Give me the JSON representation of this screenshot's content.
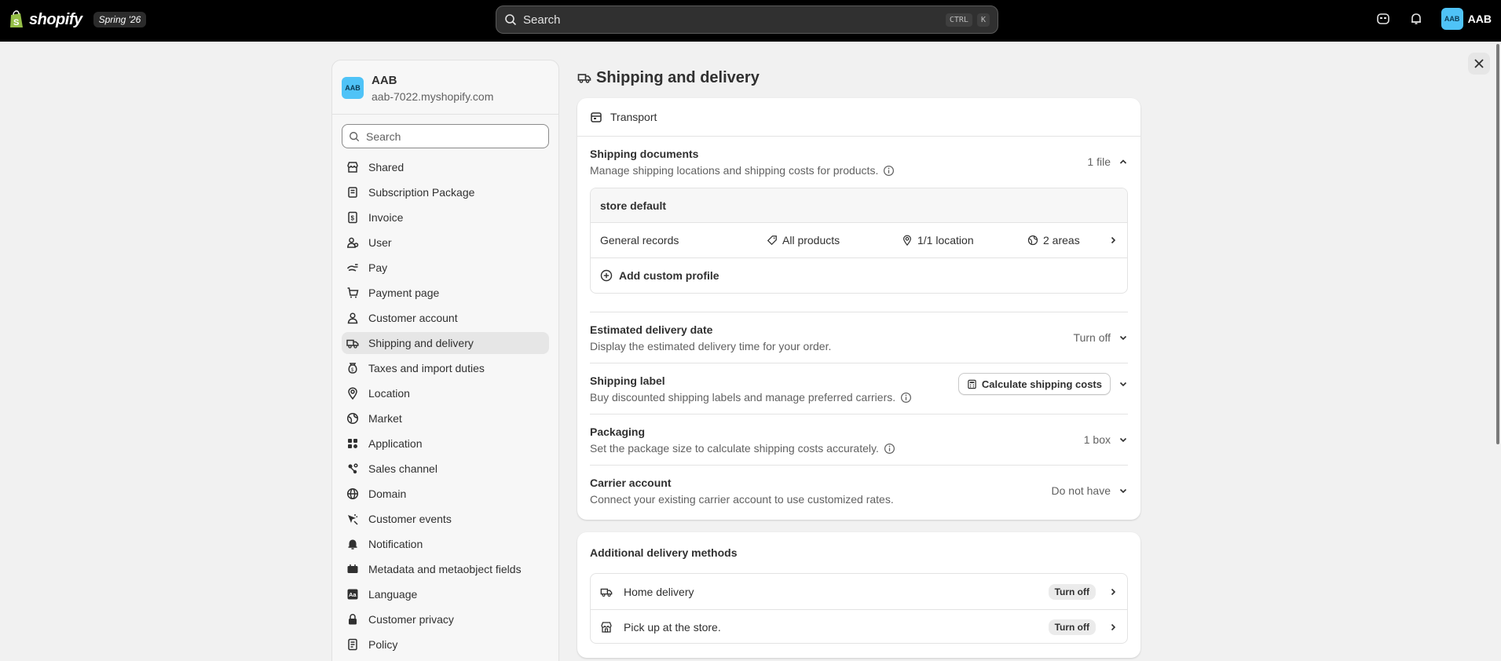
{
  "topbar": {
    "logo_text": "shopify",
    "edition": "Spring '26",
    "search_placeholder": "Search",
    "kbd_ctrl": "CTRL",
    "kbd_k": "K",
    "avatar_initials": "AAB",
    "user_label": "AAB"
  },
  "store": {
    "avatar_initials": "AAB",
    "name": "AAB",
    "domain": "aab-7022.myshopify.com"
  },
  "sidebar": {
    "search_placeholder": "Search",
    "items": [
      {
        "label": "Shared",
        "icon": "store-icon"
      },
      {
        "label": "Subscription Package",
        "icon": "plan-icon"
      },
      {
        "label": "Invoice",
        "icon": "invoice-icon"
      },
      {
        "label": "User",
        "icon": "user-icon"
      },
      {
        "label": "Pay",
        "icon": "payment-icon"
      },
      {
        "label": "Payment page",
        "icon": "cart-icon"
      },
      {
        "label": "Customer account",
        "icon": "customer-icon"
      },
      {
        "label": "Shipping and delivery",
        "icon": "truck-icon",
        "active": true
      },
      {
        "label": "Taxes and import duties",
        "icon": "tax-icon"
      },
      {
        "label": "Location",
        "icon": "location-icon"
      },
      {
        "label": "Market",
        "icon": "globe-icon"
      },
      {
        "label": "Application",
        "icon": "apps-icon"
      },
      {
        "label": "Sales channel",
        "icon": "channel-icon"
      },
      {
        "label": "Domain",
        "icon": "domain-icon"
      },
      {
        "label": "Customer events",
        "icon": "events-icon"
      },
      {
        "label": "Notification",
        "icon": "bell-icon"
      },
      {
        "label": "Metadata and metaobject fields",
        "icon": "metafield-icon"
      },
      {
        "label": "Language",
        "icon": "language-icon"
      },
      {
        "label": "Customer privacy",
        "icon": "lock-icon"
      },
      {
        "label": "Policy",
        "icon": "policy-icon"
      }
    ]
  },
  "page": {
    "title": "Shipping and delivery"
  },
  "transport": {
    "header": "Transport",
    "shipping_documents": {
      "title": "Shipping documents",
      "desc": "Manage shipping locations and shipping costs for products.",
      "count": "1 file"
    },
    "profile": {
      "name": "store default",
      "row_label": "General records",
      "products": "All products",
      "locations": "1/1 location",
      "areas": "2 areas",
      "add_label": "Add custom profile"
    },
    "estimated_delivery": {
      "title": "Estimated delivery date",
      "desc": "Display the estimated delivery time for your order.",
      "status": "Turn off"
    },
    "shipping_label": {
      "title": "Shipping label",
      "desc": "Buy discounted shipping labels and manage preferred carriers.",
      "button": "Calculate shipping costs"
    },
    "packaging": {
      "title": "Packaging",
      "desc": "Set the package size to calculate shipping costs accurately.",
      "status": "1 box"
    },
    "carrier": {
      "title": "Carrier account",
      "desc": "Connect your existing carrier account to use customized rates.",
      "status": "Do not have"
    }
  },
  "additional": {
    "title": "Additional delivery methods",
    "methods": [
      {
        "label": "Home delivery",
        "status": "Turn off",
        "icon": "truck-icon"
      },
      {
        "label": "Pick up at the store.",
        "status": "Turn off",
        "icon": "store-icon"
      }
    ]
  }
}
